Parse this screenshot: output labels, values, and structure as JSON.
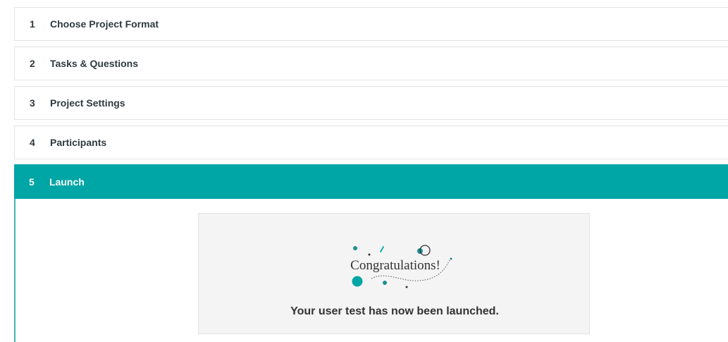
{
  "steps": [
    {
      "number": "1",
      "label": "Choose Project Format"
    },
    {
      "number": "2",
      "label": "Tasks & Questions"
    },
    {
      "number": "3",
      "label": "Project Settings"
    },
    {
      "number": "4",
      "label": "Participants"
    },
    {
      "number": "5",
      "label": "Launch"
    }
  ],
  "launch": {
    "congrats_text": "Congratulations!",
    "message": "Your user test has now been launched."
  },
  "colors": {
    "accent": "#00a5a5",
    "card_background": "#f4f4f4"
  }
}
